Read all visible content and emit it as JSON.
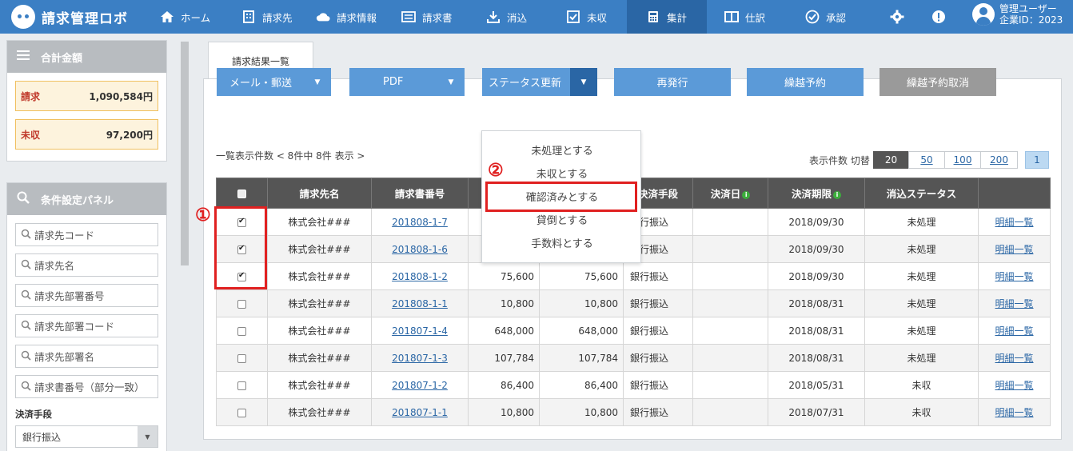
{
  "app": {
    "title": "請求管理ロボ",
    "brand_color": "#3b7fc4"
  },
  "nav": {
    "items": [
      {
        "label": "ホーム",
        "icon": "home-icon"
      },
      {
        "label": "請求先",
        "icon": "building-icon"
      },
      {
        "label": "請求情報",
        "icon": "cloud-icon"
      },
      {
        "label": "請求書",
        "icon": "list-icon"
      },
      {
        "label": "消込",
        "icon": "download-icon"
      },
      {
        "label": "未収",
        "icon": "checkbox-icon"
      },
      {
        "label": "集計",
        "icon": "calculator-icon",
        "active": true
      },
      {
        "label": "仕訳",
        "icon": "columns-icon"
      },
      {
        "label": "承認",
        "icon": "check-circle-icon"
      }
    ],
    "user": {
      "name": "管理ユーザー",
      "company": "企業ID：2023"
    }
  },
  "sidebar": {
    "totals_title": "合計金額",
    "totals": [
      {
        "label": "請求",
        "value": "1,090,584円"
      },
      {
        "label": "未収",
        "value": "97,200円"
      }
    ],
    "filter_title": "条件設定パネル",
    "filter_placeholders": [
      "請求先コード",
      "請求先名",
      "請求先部署番号",
      "請求先部署コード",
      "請求先部署名",
      "請求書番号（部分一致）"
    ],
    "payment_label": "決済手段",
    "payment_value": "銀行振込"
  },
  "main": {
    "tab_label": "請求結果一覧",
    "buttons": {
      "mail": "メール・郵送",
      "pdf": "PDF",
      "status": "ステータス更新",
      "reissue": "再発行",
      "carryover": "繰越予約",
      "carryover_cancel": "繰越予約取消"
    },
    "list_info": "一覧表示件数 < 8件中 8件 表示 >",
    "perpage_label": "表示件数 切替",
    "perpage_options": [
      "20",
      "50",
      "100",
      "200"
    ],
    "current_page": "1"
  },
  "status_menu": {
    "items": [
      "未処理とする",
      "未収とする",
      "確認済みとする",
      "貸倒とする",
      "手数料とする"
    ]
  },
  "annotations": {
    "marker1": "①",
    "marker2": "②"
  },
  "table": {
    "headers": [
      "請求先名",
      "請求書番号",
      "",
      "",
      "決済手段",
      "決済日",
      "決済期限",
      "消込ステータス",
      ""
    ],
    "rows": [
      {
        "checked": true,
        "client": "株式会社###",
        "invoice": "201808-1-7",
        "amount1": "",
        "amount2": "",
        "method": "銀行振込",
        "paid_date": "",
        "due": "2018/09/30",
        "status": "未処理",
        "link": "明細一覧"
      },
      {
        "checked": true,
        "client": "株式会社###",
        "invoice": "201808-1-6",
        "amount1": "",
        "amount2": "",
        "method": "銀行振込",
        "paid_date": "",
        "due": "2018/09/30",
        "status": "未処理",
        "link": "明細一覧"
      },
      {
        "checked": true,
        "client": "株式会社###",
        "invoice": "201808-1-2",
        "amount1": "75,600",
        "amount2": "75,600",
        "method": "銀行振込",
        "paid_date": "",
        "due": "2018/09/30",
        "status": "未処理",
        "link": "明細一覧"
      },
      {
        "checked": false,
        "client": "株式会社###",
        "invoice": "201808-1-1",
        "amount1": "10,800",
        "amount2": "10,800",
        "method": "銀行振込",
        "paid_date": "",
        "due": "2018/08/31",
        "status": "未処理",
        "link": "明細一覧"
      },
      {
        "checked": false,
        "client": "株式会社###",
        "invoice": "201807-1-4",
        "amount1": "648,000",
        "amount2": "648,000",
        "method": "銀行振込",
        "paid_date": "",
        "due": "2018/08/31",
        "status": "未処理",
        "link": "明細一覧"
      },
      {
        "checked": false,
        "client": "株式会社###",
        "invoice": "201807-1-3",
        "amount1": "107,784",
        "amount2": "107,784",
        "method": "銀行振込",
        "paid_date": "",
        "due": "2018/08/31",
        "status": "未処理",
        "link": "明細一覧"
      },
      {
        "checked": false,
        "client": "株式会社###",
        "invoice": "201807-1-2",
        "amount1": "86,400",
        "amount2": "86,400",
        "method": "銀行振込",
        "paid_date": "",
        "due": "2018/05/31",
        "status": "未収",
        "link": "明細一覧"
      },
      {
        "checked": false,
        "client": "株式会社###",
        "invoice": "201807-1-1",
        "amount1": "10,800",
        "amount2": "10,800",
        "method": "銀行振込",
        "paid_date": "",
        "due": "2018/07/31",
        "status": "未収",
        "link": "明細一覧"
      }
    ]
  }
}
